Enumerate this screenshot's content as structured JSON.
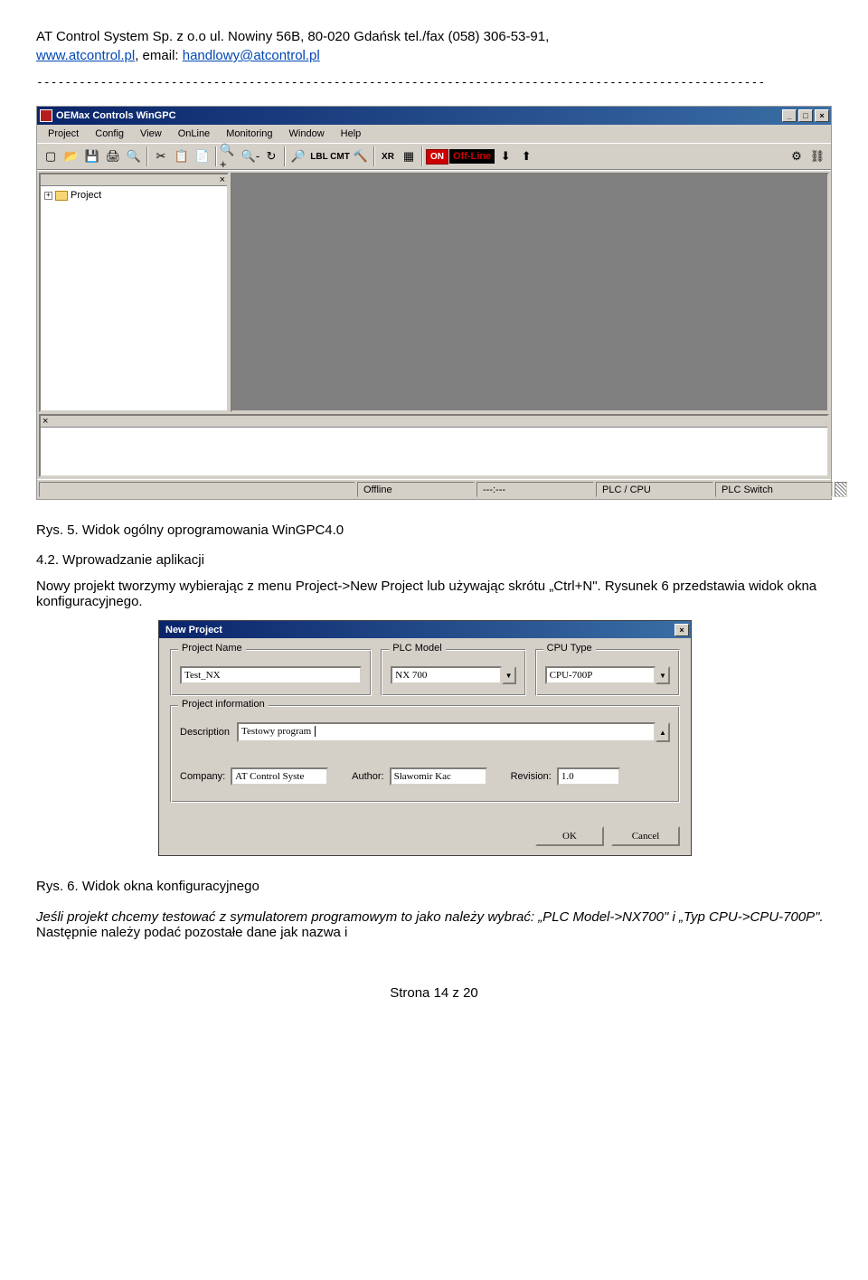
{
  "header": {
    "company_line1": "AT Control System Sp. z o.o ul. Nowiny 56B, 80-020 Gdańsk tel./fax (058) 306-53-91,",
    "website": "www.atcontrol.pl",
    "email_prefix": ", email: ",
    "email": "handlowy@atcontrol.pl"
  },
  "app": {
    "title": "OEMax Controls WinGPC",
    "menu": [
      "Project",
      "Config",
      "View",
      "OnLine",
      "Monitoring",
      "Window",
      "Help"
    ],
    "toolbar_text": {
      "lbl": "LBL",
      "cmt": "CMT",
      "xr": "XR",
      "on": "ON",
      "offline": "Off-Line"
    },
    "tree_root": "Project",
    "status": {
      "s1": "Offline",
      "s2": "---:---",
      "s3": "PLC / CPU",
      "s4": "PLC Switch"
    }
  },
  "caption1": "Rys. 5. Widok ogólny oprogramowania WinGPC4.0",
  "section_heading": "4.2. Wprowadzanie aplikacji",
  "para1": "Nowy projekt tworzymy wybierając z menu Project->New Project lub używając skrótu „Ctrl+N\". Rysunek 6 przedstawia widok okna konfiguracyjnego.",
  "dialog": {
    "title": "New Project",
    "groups": {
      "project_name": {
        "legend": "Project Name",
        "value": "Test_NX"
      },
      "plc_model": {
        "legend": "PLC Model",
        "value": "NX 700"
      },
      "cpu_type": {
        "legend": "CPU Type",
        "value": "CPU-700P"
      },
      "project_info": {
        "legend": "Project information",
        "description_label": "Description",
        "description_value": "Testowy program",
        "company_label": "Company:",
        "company_value": "AT Control Syste",
        "author_label": "Author:",
        "author_value": "Sławomir Kac",
        "revision_label": "Revision:",
        "revision_value": "1.0"
      }
    },
    "buttons": {
      "ok": "OK",
      "cancel": "Cancel"
    }
  },
  "caption2": "Rys. 6. Widok okna konfiguracyjnego",
  "para2a": "Jeśli projekt chcemy testować z symulatorem programowym to jako należy wybrać: „PLC Model->NX700\" i „Typ CPU->CPU-700P\". ",
  "para2b": "Następnie należy podać pozostałe dane jak nazwa i",
  "footer": "Strona 14 z 20"
}
